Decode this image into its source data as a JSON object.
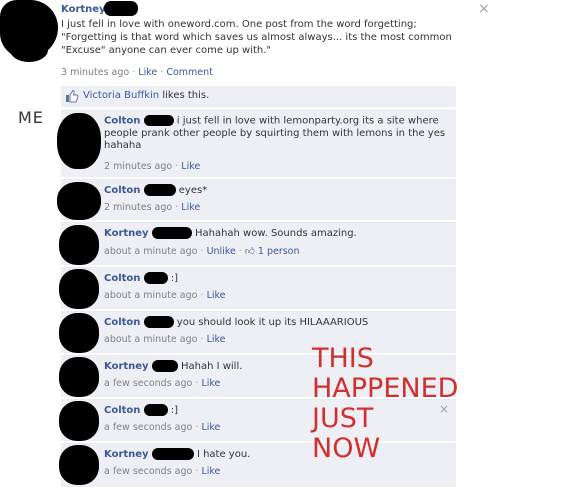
{
  "post": {
    "author": "Kortney",
    "text_line1": "I just fell in love with oneword.com. One post from the word forgetting;",
    "text_line2": "\"Forgetting is that word which saves us almost always... its the most common",
    "text_line3": "\"Excuse\" anyone can ever come up with.\"",
    "timestamp": "3 minutes ago",
    "like_label": "Like",
    "comment_label": "Comment",
    "close_glyph": "×"
  },
  "likes": {
    "liker": "Victoria Buffkin",
    "suffix": "likes this."
  },
  "me_label": "ME",
  "comments": [
    {
      "author": "Colton",
      "text1": "i just fell in love with lemonparty.org its a site where",
      "text2": "people prank other people by squirting them with lemons in the yes",
      "text3": "hahaha",
      "time": "2 minutes ago",
      "action": "Like"
    },
    {
      "author": "Colton",
      "text1": "eyes*",
      "time": "2 minutes ago",
      "action": "Like"
    },
    {
      "author": "Kortney",
      "text1": "Hahahah wow. Sounds amazing.",
      "time": "about a minute ago",
      "action": "Unlike",
      "likes": "1 person"
    },
    {
      "author": "Colton",
      "text1": ":]",
      "time": "about a minute ago",
      "action": "Like"
    },
    {
      "author": "Colton",
      "text1": "you should look it up its HILAAARIOUS",
      "time": "about a minute ago",
      "action": "Like"
    },
    {
      "author": "Kortney",
      "text1": "Hahah I will.",
      "time": "a few seconds ago",
      "action": "Like"
    },
    {
      "author": "Colton",
      "text1": ":]",
      "time": "a few seconds ago",
      "action": "Like"
    },
    {
      "author": "Kortney",
      "text1": "I hate you.",
      "time": "a few seconds ago",
      "action": "Like"
    }
  ],
  "overlay": {
    "line1": "THIS",
    "line2": "HAPPENED",
    "line3": "JUST",
    "line4": "NOW",
    "color": "#d03030"
  },
  "colors": {
    "link": "#3b5998",
    "comment_bg": "#edeff4",
    "meta": "#808080"
  }
}
